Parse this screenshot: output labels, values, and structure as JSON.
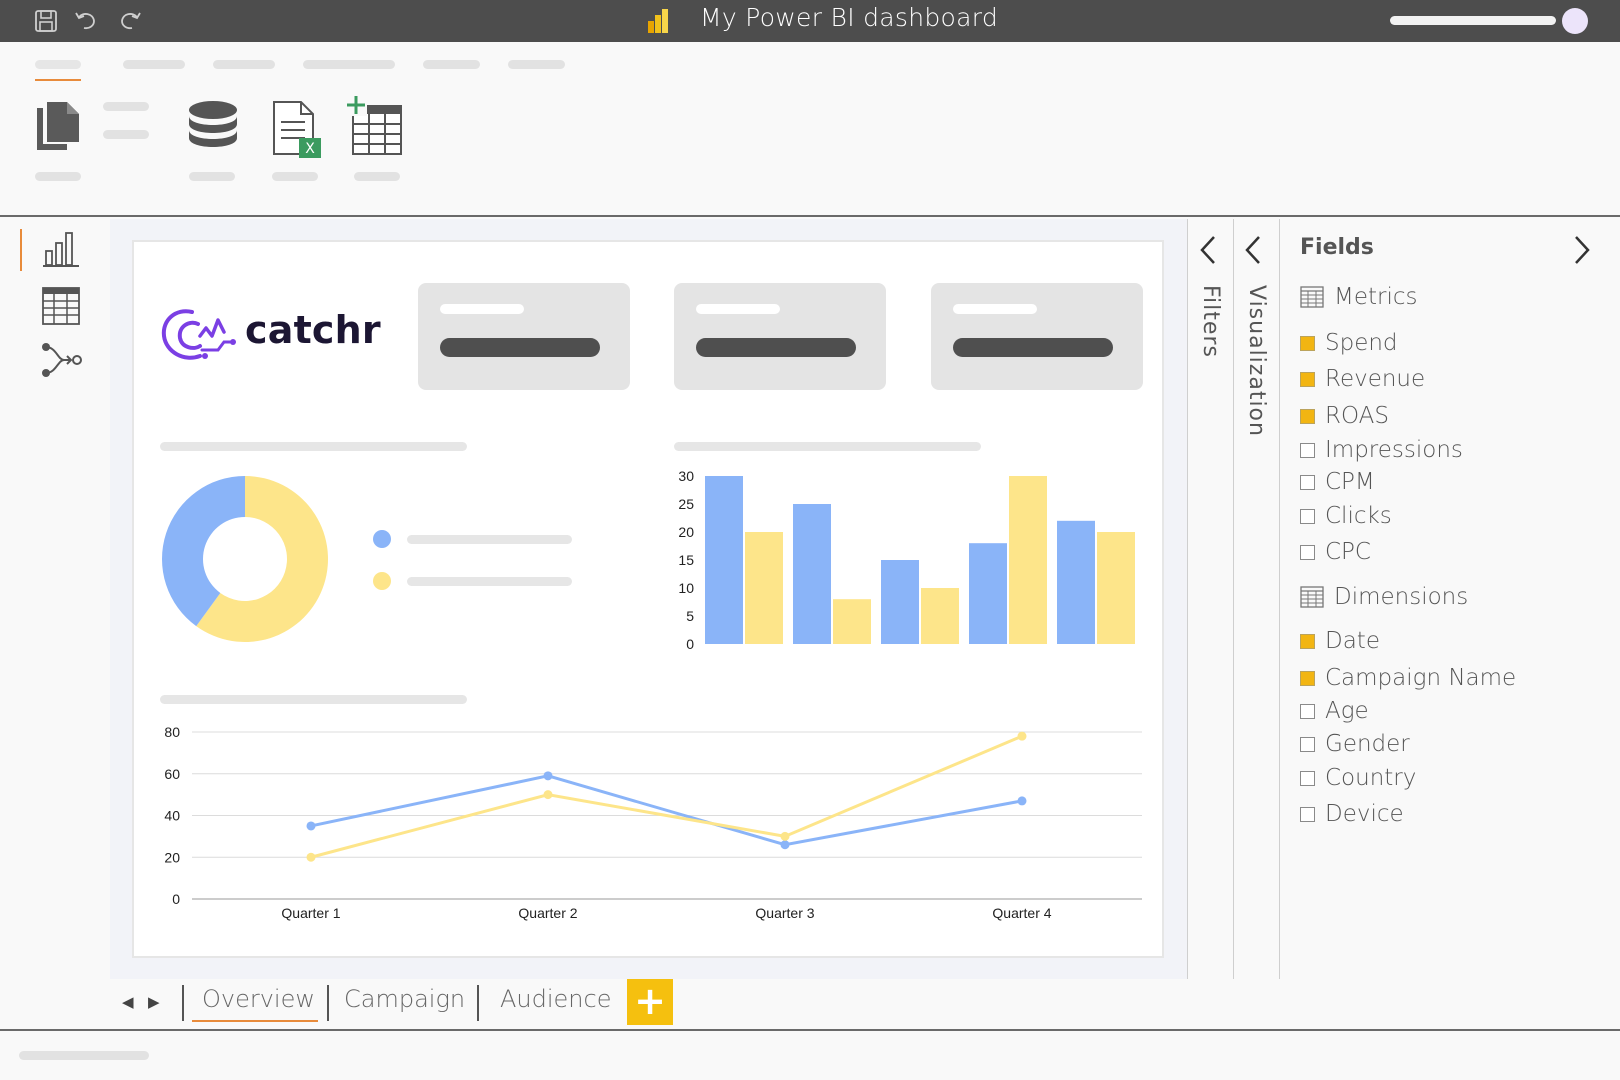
{
  "window": {
    "title": "My Power BI dashboard"
  },
  "report": {
    "logo_text": "catchr",
    "bar_chart": {
      "type": "bar",
      "yticks": [
        "30",
        "25",
        "20",
        "15",
        "10",
        "5",
        "0"
      ],
      "ylim": [
        0,
        30
      ],
      "groups": 5,
      "series": [
        {
          "color": "#8ab4f8",
          "values": [
            30,
            25,
            15,
            18,
            22
          ]
        },
        {
          "color": "#fde58a",
          "values": [
            20,
            8,
            10,
            30,
            20
          ]
        }
      ]
    },
    "line_chart": {
      "type": "line",
      "categories": [
        "Quarter 1",
        "Quarter 2",
        "Quarter 3",
        "Quarter 4"
      ],
      "yticks": [
        "80",
        "60",
        "40",
        "20",
        "0"
      ],
      "ylim": [
        0,
        80
      ],
      "series": [
        {
          "color": "#8ab4f8",
          "values": [
            35,
            59,
            26,
            47
          ]
        },
        {
          "color": "#fde58a",
          "values": [
            20,
            50,
            30,
            78
          ]
        }
      ]
    },
    "donut_chart": {
      "type": "pie",
      "slices": [
        {
          "color": "#8ab4f8",
          "value": 40
        },
        {
          "color": "#fde58a",
          "value": 60
        }
      ]
    }
  },
  "panes": {
    "filters_label": "Filters",
    "visualization_label": "Visualization"
  },
  "fields": {
    "title": "Fields",
    "metrics_label": "Metrics",
    "metrics": [
      {
        "label": "Spend",
        "checked": true
      },
      {
        "label": "Revenue",
        "checked": true
      },
      {
        "label": "ROAS",
        "checked": true
      },
      {
        "label": "Impressions",
        "checked": false
      },
      {
        "label": "CPM",
        "checked": false
      },
      {
        "label": "Clicks",
        "checked": false
      },
      {
        "label": "CPC",
        "checked": false
      }
    ],
    "dimensions_label": "Dimensions",
    "dimensions": [
      {
        "label": "Date",
        "checked": true
      },
      {
        "label": "Campaign Name",
        "checked": true
      },
      {
        "label": "Age",
        "checked": false
      },
      {
        "label": "Gender",
        "checked": false
      },
      {
        "label": "Country",
        "checked": false
      },
      {
        "label": "Device",
        "checked": false
      }
    ]
  },
  "tabs": {
    "items": [
      "Overview",
      "Campaign",
      "Audience"
    ],
    "add": "+",
    "active": "Overview"
  },
  "colors": {
    "accent": "#e88b3b",
    "yellow": "#f5c00f",
    "blue": "#8ab4f8",
    "light_yellow": "#fde58a"
  }
}
